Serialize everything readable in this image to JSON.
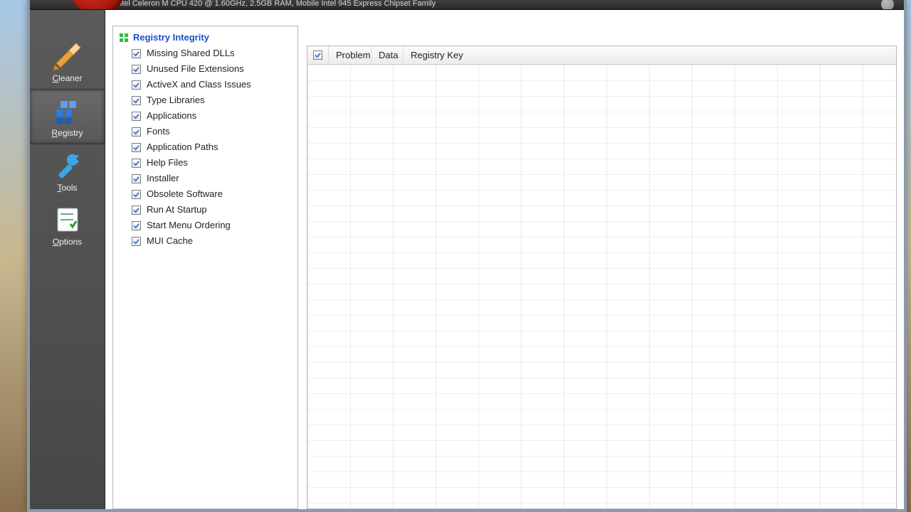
{
  "header": {
    "sysinfo": "Intel Celeron M CPU 420 @ 1.60GHz, 2.5GB RAM, Mobile Intel 945 Express Chipset Family"
  },
  "sidebar": {
    "items": [
      {
        "id": "cleaner",
        "label": "Cleaner",
        "accel": "C",
        "icon": "brush-icon"
      },
      {
        "id": "registry",
        "label": "Registry",
        "accel": "R",
        "icon": "registry-icon",
        "selected": true
      },
      {
        "id": "tools",
        "label": "Tools",
        "accel": "T",
        "icon": "wrench-icon"
      },
      {
        "id": "options",
        "label": "Options",
        "accel": "O",
        "icon": "options-icon"
      }
    ]
  },
  "tree": {
    "heading": "Registry Integrity",
    "items": [
      {
        "label": "Missing Shared DLLs",
        "checked": true
      },
      {
        "label": "Unused File Extensions",
        "checked": true
      },
      {
        "label": "ActiveX and Class Issues",
        "checked": true
      },
      {
        "label": "Type Libraries",
        "checked": true
      },
      {
        "label": "Applications",
        "checked": true
      },
      {
        "label": "Fonts",
        "checked": true
      },
      {
        "label": "Application Paths",
        "checked": true
      },
      {
        "label": "Help Files",
        "checked": true
      },
      {
        "label": "Installer",
        "checked": true
      },
      {
        "label": "Obsolete Software",
        "checked": true
      },
      {
        "label": "Run At Startup",
        "checked": true
      },
      {
        "label": "Start Menu Ordering",
        "checked": true
      },
      {
        "label": "MUI Cache",
        "checked": true
      }
    ]
  },
  "results": {
    "columns": [
      "Problem",
      "Data",
      "Registry Key"
    ],
    "select_all_checked": true,
    "rows": []
  }
}
